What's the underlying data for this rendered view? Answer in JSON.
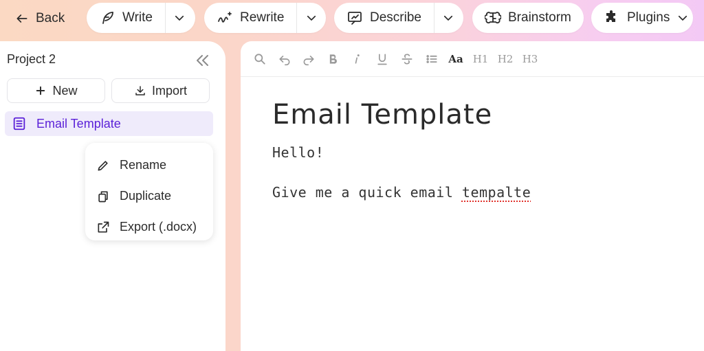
{
  "topbar": {
    "back_label": "Back",
    "write_label": "Write",
    "rewrite_label": "Rewrite",
    "describe_label": "Describe",
    "brainstorm_label": "Brainstorm",
    "plugins_label": "Plugins"
  },
  "sidebar": {
    "project_title": "Project 2",
    "new_label": "New",
    "import_label": "Import",
    "documents": [
      {
        "label": "Email Template",
        "selected": true
      }
    ],
    "context_menu": [
      {
        "label": "Rename",
        "icon": "pencil-icon"
      },
      {
        "label": "Duplicate",
        "icon": "duplicate-icon"
      },
      {
        "label": "Export (.docx)",
        "icon": "external-link-icon"
      }
    ]
  },
  "editor": {
    "toolbar": {
      "font_size_label": "Aa",
      "h1_label": "H1",
      "h2_label": "H2",
      "h3_label": "H3"
    },
    "title": "Email Template",
    "line1": "Hello!",
    "line2_prefix": "Give me a quick email ",
    "line2_misspelled": "tempalte"
  },
  "colors": {
    "accent": "#5b21d8",
    "selected_bg": "#efebfb",
    "spellcheck": "#e0302a"
  }
}
